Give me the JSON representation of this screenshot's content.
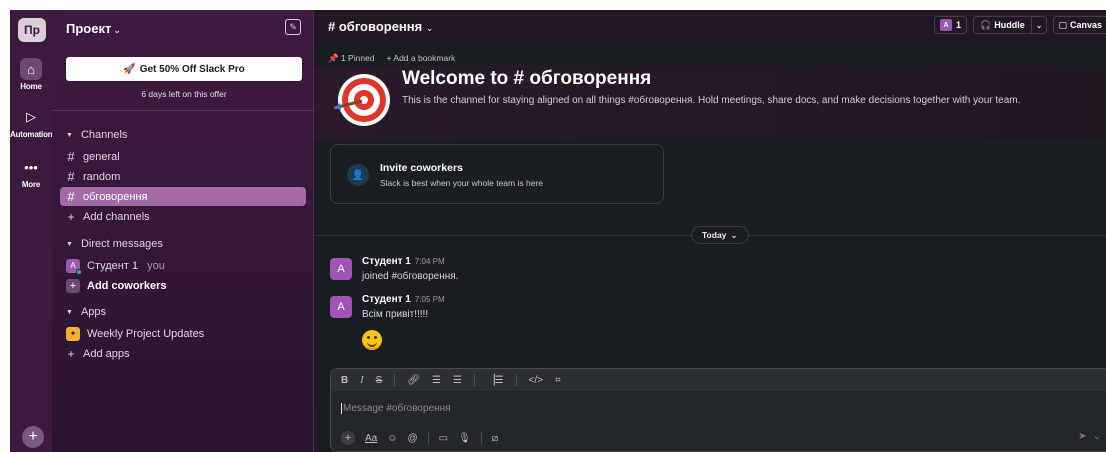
{
  "rail": {
    "workspace_abbr": "Пр",
    "items": [
      {
        "label": "Home",
        "icon": "home-icon"
      },
      {
        "label": "Automations",
        "icon": "play-icon"
      },
      {
        "label": "More",
        "icon": "ellipsis-icon"
      }
    ],
    "add_glyph": "+"
  },
  "sidebar": {
    "workspace_name": "Проект",
    "promo_button": "Get 50% Off Slack Pro",
    "promo_subtext": "6 days left on this offer",
    "channels_header": "Channels",
    "channels": [
      "general",
      "random",
      "обговорення"
    ],
    "active_channel": "обговорення",
    "add_channels": "Add channels",
    "dm_header": "Direct messages",
    "dm_user": "Студент 1",
    "dm_user_avatar": "A",
    "dm_you": "you",
    "add_coworkers": "Add coworkers",
    "apps_header": "Apps",
    "app_item": "Weekly Project Updates",
    "add_apps": "Add apps"
  },
  "header": {
    "channel_title": "# обговорення",
    "member_avatar": "A",
    "member_count": "1",
    "huddle_label": "Huddle",
    "canvas_label": "Canvas",
    "pinned": "1 Pinned",
    "add_bookmark": "Add a bookmark"
  },
  "welcome": {
    "title": "Welcome to # обговорення",
    "description": "This is the channel for staying aligned on all things #обговорення. Hold meetings, share docs, and make decisions together with your team."
  },
  "invite": {
    "title": "Invite coworkers",
    "subtitle": "Slack is best when your whole team is here"
  },
  "divider_label": "Today",
  "messages": [
    {
      "avatar": "A",
      "author": "Студент 1",
      "time": "7:04 PM",
      "text": "joined #обговорення."
    },
    {
      "avatar": "A",
      "author": "Студент 1",
      "time": "7:05 PM",
      "text": "Всім привіт!!!!!"
    }
  ],
  "composer": {
    "placeholder": "Message #обговорення",
    "format_buttons": [
      "B",
      "I",
      "S"
    ],
    "text_style_label": "Aa"
  },
  "colors": {
    "rail_bg": "#3b1a3d",
    "sidebar_bg": "#3e1a40",
    "active_item": "#a46aa7",
    "main_bg": "#1a1d21",
    "avatar": "#a055b5"
  }
}
